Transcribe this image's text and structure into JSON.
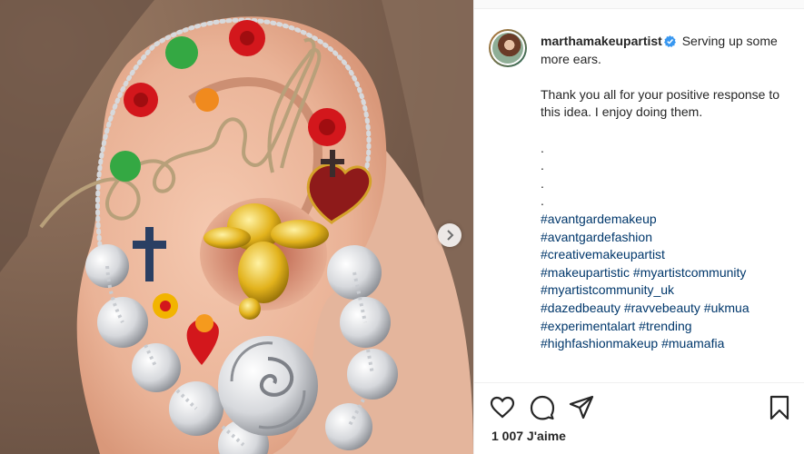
{
  "post": {
    "author": {
      "username": "marthamakeupartist",
      "verified": true
    },
    "caption": {
      "first_line": "Serving up some more ears.",
      "paragraph": "Thank you all for your positive response to this idea. I enjoy doing them.",
      "dots": [
        ".",
        ".",
        ".",
        "."
      ],
      "hashtag_lines": [
        "#avantgardemakeup",
        "#avantgardefashion",
        "#creativemakeupartist",
        "#makeupartistic #myartistcommunity",
        "#myartistcommunity_uk",
        "#dazedbeauty #ravvebeauty #ukmua",
        "#experimentalart #trending",
        "#highfashionmakeup #muamafia"
      ]
    },
    "likes_text": "1 007 J'aime",
    "icons": {
      "like": "heart-icon",
      "comment": "comment-bubble-icon",
      "share": "paper-plane-icon",
      "save": "bookmark-icon",
      "next": "chevron-right-icon",
      "verified": "verified-badge-icon"
    },
    "colors": {
      "link": "#00376b",
      "verified": "#3897f0",
      "text": "#262626"
    }
  }
}
